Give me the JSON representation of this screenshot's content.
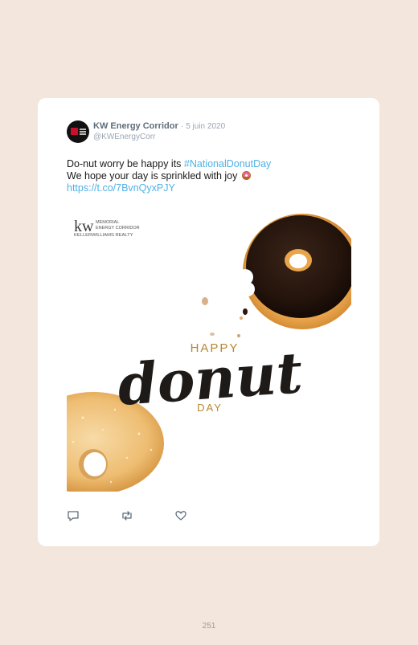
{
  "tweet": {
    "author_name": "KW Energy Corridor",
    "separator": "·",
    "date": "5 juin 2020",
    "handle": "@KWEnergyCorr",
    "text_line1_prefix": "Do-nut worry be happy its ",
    "hashtag": "#NationalDonutDay",
    "text_line2": "We hope your day is sprinkled with joy",
    "emoji": "doughnut-emoji",
    "link": "https://t.co/7BvnQyxPJY"
  },
  "media": {
    "logo_kw": "kw",
    "logo_line1": "MEMORIAL",
    "logo_line2": "ENERGY CORRIDOR",
    "logo_line3": "KELLERWILLIAMS REALTY",
    "happy": "HAPPY",
    "donut": "donut",
    "day": "DAY"
  },
  "actions": {
    "reply_icon": "reply-icon",
    "retweet_icon": "retweet-icon",
    "like_icon": "heart-icon"
  },
  "footer": {
    "page_number": "251"
  },
  "colors": {
    "background": "#f3e7dd",
    "link_blue": "#4fb1e6",
    "gold": "#b8862f"
  }
}
